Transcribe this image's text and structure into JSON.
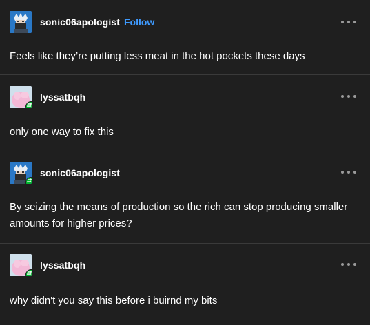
{
  "thread": [
    {
      "username": "sonic06apologist",
      "follow_label": "Follow",
      "avatar_icon": "ninja-character-avatar",
      "text": "Feels like they’re putting less meat in the hot pockets these days"
    },
    {
      "username": "lyssatbqh",
      "avatar_icon": "pink-character-avatar",
      "badge_icon": "reblog-icon",
      "text": "only one way to fix this"
    },
    {
      "username": "sonic06apologist",
      "avatar_icon": "ninja-character-avatar",
      "badge_icon": "reblog-icon",
      "text": "By seizing the means of production so the rich can stop producing smaller amounts for higher prices?"
    },
    {
      "username": "lyssatbqh",
      "avatar_icon": "pink-character-avatar",
      "badge_icon": "reblog-icon",
      "text": "why didn't you say this before i buirnd my bits"
    }
  ],
  "colors": {
    "background": "#1f1f1f",
    "text": "#ffffff",
    "follow": "#3f9bff",
    "reblog_badge": "#00b82e",
    "divider": "#3a3a3a"
  }
}
